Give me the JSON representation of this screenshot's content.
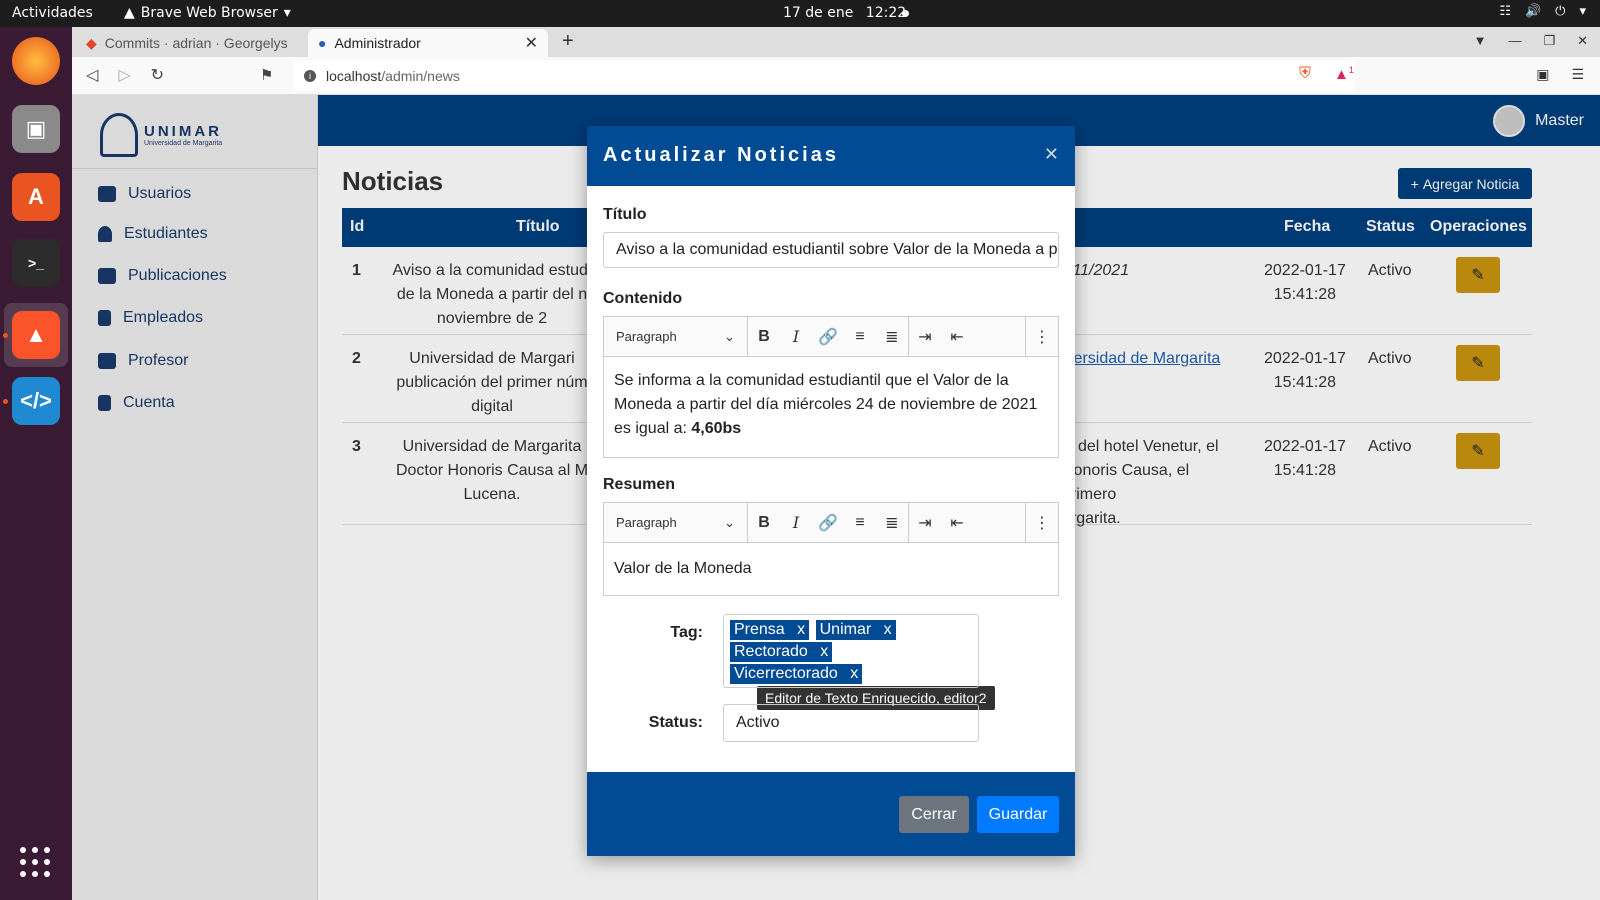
{
  "os": {
    "activities": "Actividades",
    "app_name": "Brave Web Browser",
    "date": "17 de ene",
    "time": "12:22"
  },
  "browser": {
    "tabs": [
      {
        "label": "Commits · adrian · Georgelys"
      },
      {
        "label": "Administrador"
      }
    ],
    "url_host": "localhost",
    "url_path": "/admin/news",
    "rewards_badge": "1"
  },
  "sidebar": {
    "logo_text": "UNIMAR",
    "logo_subtext": "Universidad de Margarita",
    "items": [
      {
        "label": "Usuarios"
      },
      {
        "label": "Estudiantes"
      },
      {
        "label": "Publicaciones"
      },
      {
        "label": "Empleados"
      },
      {
        "label": "Profesor"
      },
      {
        "label": "Cuenta"
      }
    ]
  },
  "header": {
    "user": "Master"
  },
  "page": {
    "title": "Noticias",
    "add_button": "Agregar Noticia",
    "columns": [
      "Id",
      "Título",
      "Fecha",
      "Status",
      "Operaciones"
    ],
    "rows": [
      {
        "id": "1",
        "t1": "Aviso a la comunidad estudi",
        "t2": "de la Moneda a partir del n",
        "t3": "noviembre de 2",
        "desc": "/11/2021",
        "date": "2022-01-17",
        "time": "15:41:28",
        "status": "Activo"
      },
      {
        "id": "2",
        "t1": "Universidad de Margari",
        "t2": "publicación del primer núm",
        "t3": "digital",
        "desc": "iversidad de Margarita",
        "date": "2022-01-17",
        "time": "15:41:28",
        "status": "Activo"
      },
      {
        "id": "3",
        "t1": "Universidad de Margarita",
        "t2": "Doctor Honoris Causa al M",
        "t3": "Lucena.",
        "desc1": "iz del hotel Venetur, el",
        "desc2": "Honoris Causa, el primero",
        "desc3": "argarita.",
        "date": "2022-01-17",
        "time": "15:41:28",
        "status": "Activo"
      }
    ]
  },
  "modal": {
    "title": "Actualizar Noticias",
    "titulo_label": "Título",
    "titulo_value": "Aviso a la comunidad estudiantil sobre Valor de la Moneda a partir",
    "contenido_label": "Contenido",
    "paragraph": "Paragraph",
    "contenido_text": "Se informa a la comunidad estudiantil que el Valor de la Moneda a partir del día miércoles 24 de noviembre de 2021 es igual a:",
    "contenido_bold": "4,60bs",
    "resumen_label": "Resumen",
    "resumen_text": "Valor de la Moneda",
    "tooltip": "Editor de Texto Enriquecido, editor2",
    "tag_label": "Tag:",
    "tags": [
      "Prensa",
      "Unimar",
      "Rectorado",
      "Vicerrectorado"
    ],
    "status_label": "Status:",
    "status_value": "Activo",
    "close_button": "Cerrar",
    "save_button": "Guardar"
  }
}
